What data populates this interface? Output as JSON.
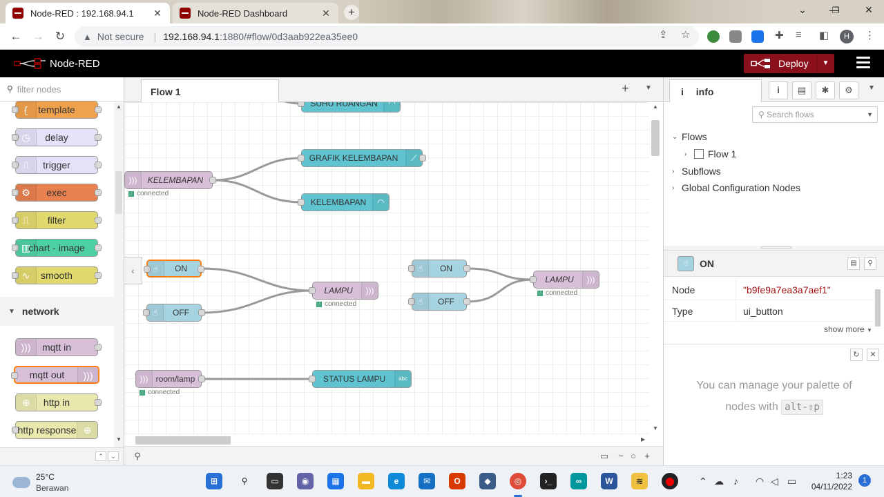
{
  "browser": {
    "tabs": [
      {
        "title": "Node-RED : 192.168.94.1",
        "active": true
      },
      {
        "title": "Node-RED Dashboard",
        "active": false
      }
    ],
    "security_label": "Not secure",
    "url_host": "192.168.94.1",
    "url_path": ":1880/#flow/0d3aab922ea35ee0",
    "profile_initial": "H"
  },
  "app": {
    "title": "Node-RED",
    "deploy_label": "Deploy"
  },
  "palette": {
    "search_placeholder": "filter nodes",
    "nodes": [
      {
        "label": "template",
        "color": "#f0a14b",
        "icon": "braces-icon"
      },
      {
        "label": "delay",
        "color": "#e6e0f8",
        "icon": "clock-icon"
      },
      {
        "label": "trigger",
        "color": "#e6e0f8",
        "icon": "trigger-icon"
      },
      {
        "label": "exec",
        "color": "#e8804f",
        "icon": "cog-icon"
      },
      {
        "label": "filter",
        "color": "#e2d96e",
        "icon": "filter-icon"
      },
      {
        "label": "chart - image",
        "color": "#4ed0a6",
        "icon": "bar-chart-icon"
      },
      {
        "label": "smooth",
        "color": "#e2d96e",
        "icon": "wave-icon"
      }
    ],
    "category": "network",
    "network_nodes": [
      {
        "label": "mqtt in",
        "color": "#d8bfd8"
      },
      {
        "label": "mqtt out",
        "color": "#d8bfd8"
      },
      {
        "label": "http in",
        "color": "#e7e7ae"
      },
      {
        "label": "http response",
        "color": "#e7e7ae"
      }
    ]
  },
  "workspace": {
    "tab_label": "Flow 1",
    "nodes": {
      "suhu": "SUHU RUANGAN",
      "kelembapan_in": "KELEMBAPAN",
      "grafik": "GRAFIK KELEMBAPAN",
      "kelembapan_gauge": "KELEMBAPAN",
      "on_1": "ON",
      "off_1": "OFF",
      "lampu_1": "LAMPU",
      "on_2": "ON",
      "off_2": "OFF",
      "lampu_2": "LAMPU",
      "room_lamp": "room/lamp",
      "status_lampu": "STATUS LAMPU"
    },
    "status_text": "connected",
    "colors": {
      "mqtt": "#d8bfd8",
      "dashboard": "#5fc4cf",
      "button": "#a6d3e0"
    }
  },
  "sidebar": {
    "tab_label": "info",
    "search_placeholder": "Search flows",
    "tree": {
      "flows": "Flows",
      "flow1": "Flow 1",
      "subflows": "Subflows",
      "global": "Global Configuration Nodes"
    },
    "selected_node": {
      "title": "ON",
      "node_key": "Node",
      "node_value": "\"b9fe9a7ea3a7aef1\"",
      "type_key": "Type",
      "type_value": "ui_button",
      "show_more": "show more"
    },
    "help": {
      "text_before": "You can manage your palette of nodes with",
      "shortcut": "alt-⇧p"
    }
  },
  "taskbar": {
    "temperature": "25°C",
    "weather": "Berawan",
    "time": "1:23",
    "date": "04/11/2022",
    "notifications": "1"
  }
}
